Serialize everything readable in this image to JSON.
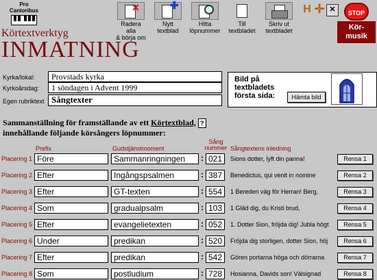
{
  "logo": {
    "line1": "Pro",
    "line2": "Cantoribus"
  },
  "app": {
    "subtitle": "Körtextverktyg",
    "title": "INMATNING"
  },
  "toolbar": {
    "radera": "Radera alla\n& börja om",
    "nytt": "Nytt\ntextblad",
    "hitta": "Hitta\nlöpnummer",
    "till": "Till\ntextbladet",
    "skriv": "Skriv ut\ntextbladet",
    "stop": "STOP",
    "kor": "Kör-\nmusik"
  },
  "info": {
    "kyrka_label": "Kyrka/lokal:",
    "kyrka_value": "Provstads kyrka",
    "dag_label": "Kyrkoårsdag:",
    "dag_value": "1 söndagen i Advent 1999",
    "rubrik_label": "Egen rubriktext",
    "rubrik_value": "Sångtexter"
  },
  "bild": {
    "title": "Bild på textbladets första sida:",
    "button": "Hämta bild"
  },
  "heading": {
    "line1": "Sammanställning för framställande av ett",
    "link": "Körtextblad,",
    "help": "?",
    "line2": "innehållande följande körsångers löpnummer:"
  },
  "columns": {
    "prefix": "Prefix",
    "moment": "Gudstjänstmoment",
    "nummer_top": "Sång",
    "nummer_bottom": "nummer",
    "inledning": "Sångtextens inledning"
  },
  "rows": [
    {
      "label": "Placering 1",
      "prefix": "Före",
      "moment": "Sammanringningen",
      "nummer": "021",
      "inledning": "Sions dotter, lyft din panna!",
      "rensa": "Rensa 1"
    },
    {
      "label": "Placering 2",
      "prefix": "Efter",
      "moment": "Ingångspsalmen",
      "nummer": "387",
      "inledning": "Benedictus, qui venit in nomine",
      "rensa": "Rensa 2"
    },
    {
      "label": "Placering 3",
      "prefix": "Efter",
      "moment": "GT-texten",
      "nummer": "554",
      "inledning": "1 Bereden väg för Herran! Berg,",
      "rensa": "Rensa 3"
    },
    {
      "label": "Placering 4",
      "prefix": "Som",
      "moment": "gradualpsalm",
      "nummer": "103",
      "inledning": "1 Gläd dig, du Kristi brud,",
      "rensa": "Rensa 4"
    },
    {
      "label": "Placering 5",
      "prefix": "Efter",
      "moment": "evangelietexten",
      "nummer": "052",
      "inledning": "1. Dotter Sion, fröjda dig! Jubla högt",
      "rensa": "Rensa 5"
    },
    {
      "label": "Placering 6",
      "prefix": "Under",
      "moment": "predikan",
      "nummer": "520",
      "inledning": "Fröjda dig storligen, dotter Sion, höj",
      "rensa": "Rensa 6"
    },
    {
      "label": "Placering 7",
      "prefix": "Efter",
      "moment": "predikan",
      "nummer": "542",
      "inledning": "Gören portarna höga och dörrarna",
      "rensa": "Rensa 7"
    },
    {
      "label": "Placering 8",
      "prefix": "Som",
      "moment": "postludium",
      "nummer": "728",
      "inledning": "Hosianna, Davids son! Välsignad",
      "rensa": "Rensa 8"
    }
  ]
}
